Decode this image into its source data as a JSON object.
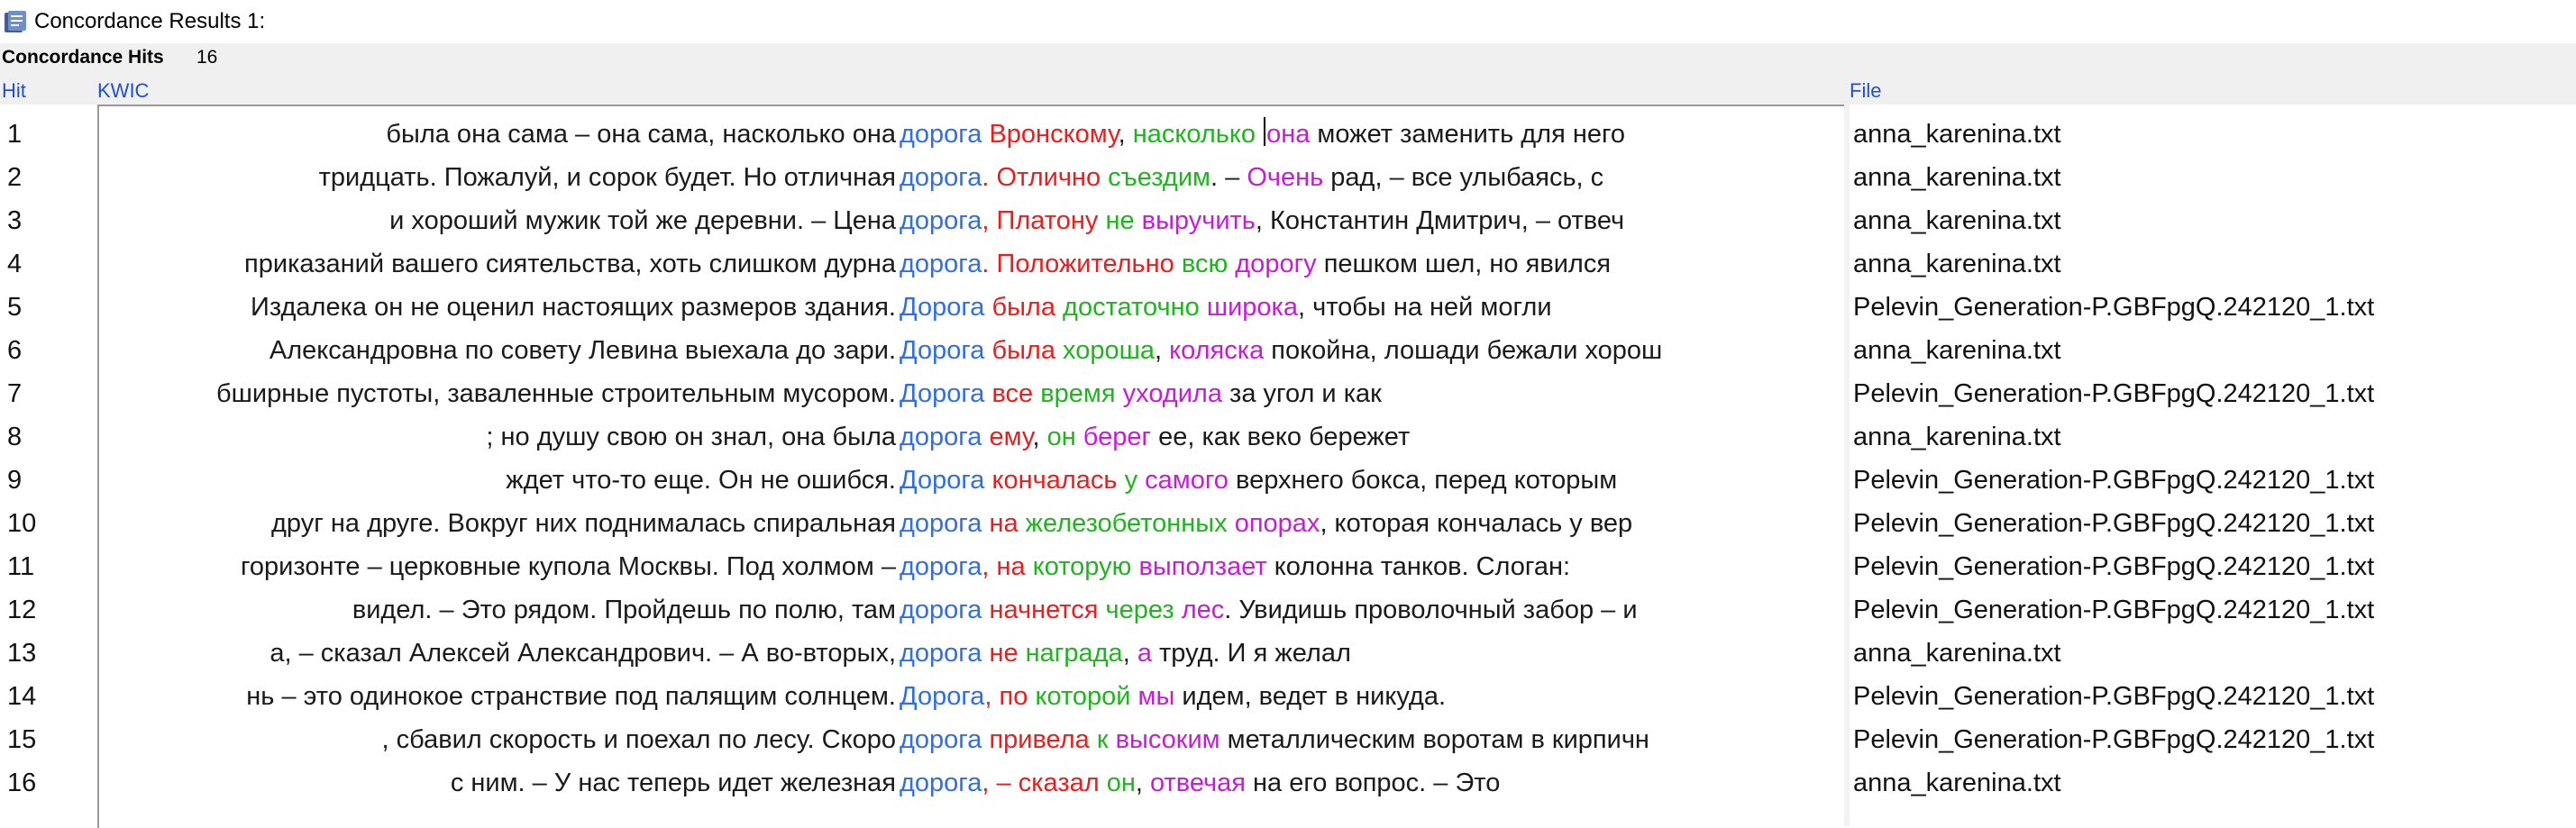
{
  "window": {
    "title": "Concordance Results 1:"
  },
  "hits": {
    "label": "Concordance Hits",
    "count": "16"
  },
  "columns": {
    "hit": "Hit",
    "kwic": "KWIC",
    "file": "File"
  },
  "rows": [
    {
      "hit": "1",
      "left": "была она сама – она сама, насколько она",
      "node": "дорога",
      "r1": " Вронскому",
      "s1": ", ",
      "r2": "насколько",
      "s2": " ",
      "r3": "она",
      "rest": " может заменить для него",
      "file": "anna_karenina.txt"
    },
    {
      "hit": "2",
      "left": "тридцать. Пожалуй, и сорок будет. Но отличная",
      "node": "дорога",
      "r1": ". Отлично",
      "s1": " ",
      "r2": "съездим",
      "s2": ".  – ",
      "r3": "Очень",
      "rest": " рад, – все улыбаясь, с",
      "file": "anna_karenina.txt"
    },
    {
      "hit": "3",
      "left": "и хороший мужик той же деревни.  – Цена",
      "node": "дорога",
      "r1": ", Платону",
      "s1": " ",
      "r2": "не",
      "s2": " ",
      "r3": "выручить",
      "rest": ", Константин Дмитрич, – отвеч",
      "file": "anna_karenina.txt"
    },
    {
      "hit": "4",
      "left": "приказаний вашего сиятельства, хоть слишком дурна",
      "node": "дорога",
      "r1": ". Положительно",
      "s1": " ",
      "r2": "всю",
      "s2": " ",
      "r3": "дорогу",
      "rest": " пешком шел, но явился",
      "file": "anna_karenina.txt"
    },
    {
      "hit": "5",
      "left": "Издалека он не оценил настоящих размеров здания.",
      "node": "Дорога",
      "r1": " была",
      "s1": " ",
      "r2": "достаточно",
      "s2": " ",
      "r3": "широка",
      "rest": ", чтобы на ней могли",
      "file": "Pelevin_Generation-P.GBFpgQ.242120_1.txt"
    },
    {
      "hit": "6",
      "left": "Александровна по совету Левина выехала до зари.",
      "node": "Дорога",
      "r1": " была",
      "s1": " ",
      "r2": "хороша",
      "s2": ", ",
      "r3": "коляска",
      "rest": " покойна, лошади бежали хорош",
      "file": "anna_karenina.txt"
    },
    {
      "hit": "7",
      "left": "бширные пустоты, заваленные строительным мусором.",
      "node": "Дорога",
      "r1": " все",
      "s1": " ",
      "r2": "время",
      "s2": " ",
      "r3": "уходила",
      "rest": " за угол и как",
      "file": "Pelevin_Generation-P.GBFpgQ.242120_1.txt"
    },
    {
      "hit": "8",
      "left": "; но душу свою он знал, она была",
      "node": "дорога",
      "r1": " ему",
      "s1": ", ",
      "r2": "он",
      "s2": " ",
      "r3": "берег",
      "rest": " ее, как веко бережет",
      "file": "anna_karenina.txt"
    },
    {
      "hit": "9",
      "left": "ждет что-то еще.  Он не ошибся.",
      "node": "Дорога",
      "r1": " кончалась",
      "s1": " ",
      "r2": "у",
      "s2": " ",
      "r3": "самого",
      "rest": " верхнего бокса, перед которым",
      "file": "Pelevin_Generation-P.GBFpgQ.242120_1.txt"
    },
    {
      "hit": "10",
      "left": "друг на друге. Вокруг них поднималась спиральная",
      "node": "дорога",
      "r1": " на",
      "s1": " ",
      "r2": "железобетонных",
      "s2": " ",
      "r3": "опорах",
      "rest": ", которая кончалась у вер",
      "file": "Pelevin_Generation-P.GBFpgQ.242120_1.txt"
    },
    {
      "hit": "11",
      "left": "горизонте – церковные купола Москвы. Под холмом –",
      "node": "дорога",
      "r1": ", на",
      "s1": " ",
      "r2": "которую",
      "s2": " ",
      "r3": "выползает",
      "rest": " колонна танков. Слоган:",
      "file": "Pelevin_Generation-P.GBFpgQ.242120_1.txt"
    },
    {
      "hit": "12",
      "left": "видел.  – Это рядом. Пройдешь по полю, там",
      "node": "дорога",
      "r1": " начнется",
      "s1": " ",
      "r2": "через",
      "s2": " ",
      "r3": "лес",
      "rest": ". Увидишь проволочный забор – и",
      "file": "Pelevin_Generation-P.GBFpgQ.242120_1.txt"
    },
    {
      "hit": "13",
      "left": "а, – сказал Алексей Александрович. – А во-вторых,",
      "node": "дорога",
      "r1": " не",
      "s1": " ",
      "r2": "награда",
      "s2": ", ",
      "r3": "а",
      "rest": " труд. И я желал",
      "file": "anna_karenina.txt"
    },
    {
      "hit": "14",
      "left": "нь – это одинокое странствие под палящим солнцем.",
      "node": "Дорога",
      "r1": ", по",
      "s1": " ",
      "r2": "которой",
      "s2": " ",
      "r3": "мы",
      "rest": " идем, ведет в никуда.",
      "file": "Pelevin_Generation-P.GBFpgQ.242120_1.txt"
    },
    {
      "hit": "15",
      "left": ", сбавил скорость и поехал по лесу. Скоро",
      "node": "дорога",
      "r1": " привела",
      "s1": " ",
      "r2": "к",
      "s2": " ",
      "r3": "высоким",
      "rest": " металлическим воротам в кирпичн",
      "file": "Pelevin_Generation-P.GBFpgQ.242120_1.txt"
    },
    {
      "hit": "16",
      "left": "с ним.  – У нас теперь идет железная",
      "node": "дорога",
      "r1": ", – сказал",
      "s1": " ",
      "r2": "он",
      "s2": ", ",
      "r3": "отвечая",
      "rest": " на его вопрос. – Это",
      "file": "anna_karenina.txt"
    }
  ],
  "colors": {
    "node": "#2f6ee8",
    "r1": "#ee1c1c",
    "r2": "#1fb51f",
    "r3": "#c81bd9",
    "header_text": "#1f4fd8"
  }
}
